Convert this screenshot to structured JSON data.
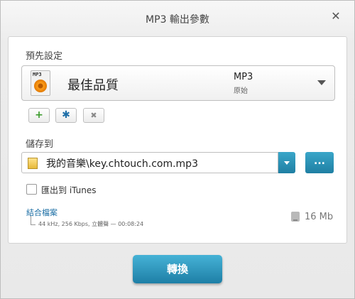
{
  "window": {
    "title": "MP3 輸出參數",
    "close_glyph": "✕"
  },
  "preset": {
    "section_label": "預先設定",
    "icon_tag": "MP3",
    "name": "最佳品質",
    "format": "MP3",
    "subtitle": "原始",
    "icon": "mp3-file-icon",
    "accent": "#ff9e1a"
  },
  "toolbar": {
    "add_glyph": "+",
    "settings_glyph": "✱",
    "delete_glyph": "✖",
    "add_color": "#3a9b2a",
    "settings_color": "#1f6fa8",
    "delete_color": "#8a8a8a"
  },
  "save": {
    "section_label": "儲存到",
    "path": "我的音樂\\key.chtouch.com.mp3",
    "browse_label": "...",
    "folder_icon": "folder-icon"
  },
  "itunes": {
    "label": "匯出到 iTunes",
    "checked": false
  },
  "merge": {
    "link": "結合檔案",
    "meta": "44 kHz, 256 Kbps, 立體聲 — 00:08:24"
  },
  "size": {
    "value": "16 Mb",
    "icon": "hdd-icon"
  },
  "convert_button": {
    "label": "轉換",
    "color": "#1e7fa6"
  }
}
